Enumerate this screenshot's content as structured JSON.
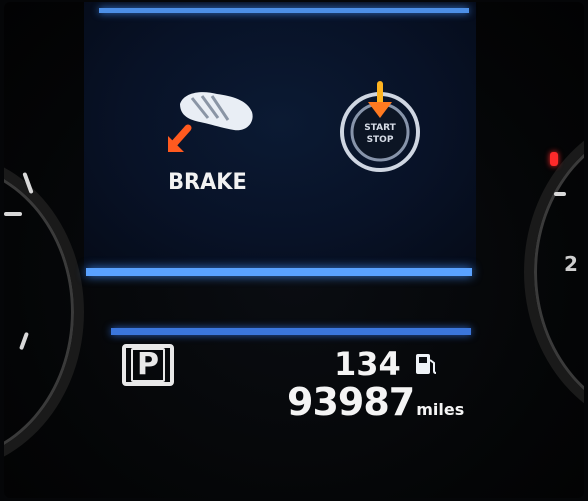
{
  "warnings": {
    "brake": {
      "icon": "brake-warning-icon",
      "label": "BRAKE"
    },
    "start_stop": {
      "icon": "start-stop-button-icon",
      "label_line1": "START",
      "label_line2": "STOP"
    }
  },
  "status": {
    "gear": {
      "icon": "park-gear-icon",
      "label": "P"
    },
    "range": {
      "value": "134",
      "icon": "fuel-pump-icon"
    },
    "odometer": {
      "value": "93987",
      "unit": "miles"
    }
  },
  "colors": {
    "display_background": "#081227",
    "accent_line": "#4d8fe6",
    "warning_orange": "#ff5a1f",
    "text": "#f2f2f2",
    "needle_red": "#ff2a2a"
  }
}
